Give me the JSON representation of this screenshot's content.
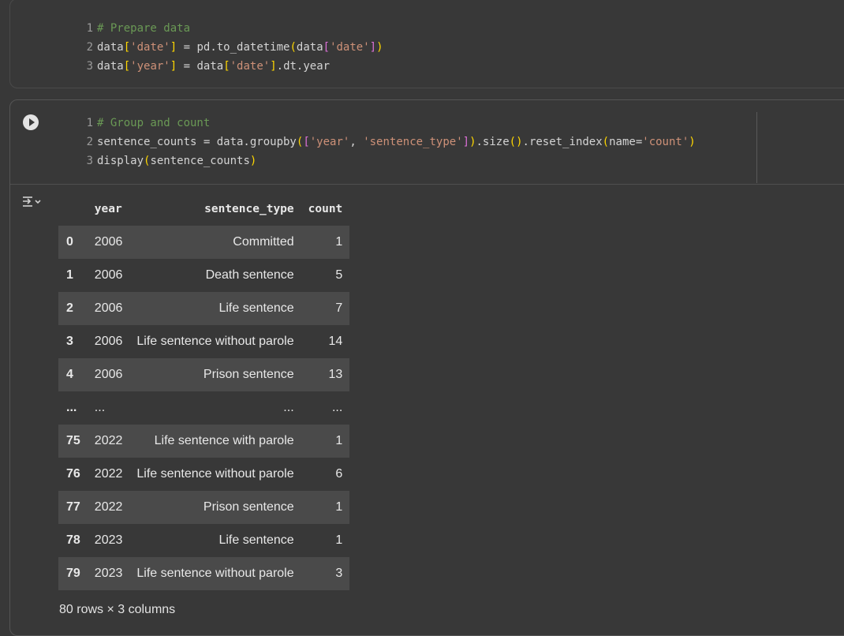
{
  "cell1": {
    "lines": [
      {
        "n": "1",
        "parts": [
          {
            "c": "cm",
            "t": "# Prepare data"
          }
        ]
      },
      {
        "n": "2",
        "parts": [
          {
            "c": "",
            "t": "data"
          },
          {
            "c": "br1",
            "t": "["
          },
          {
            "c": "str",
            "t": "'date'"
          },
          {
            "c": "br1",
            "t": "]"
          },
          {
            "c": "",
            "t": " = pd.to_datetime"
          },
          {
            "c": "br1",
            "t": "("
          },
          {
            "c": "",
            "t": "data"
          },
          {
            "c": "br2",
            "t": "["
          },
          {
            "c": "str",
            "t": "'date'"
          },
          {
            "c": "br2",
            "t": "]"
          },
          {
            "c": "br1",
            "t": ")"
          }
        ]
      },
      {
        "n": "3",
        "parts": [
          {
            "c": "",
            "t": "data"
          },
          {
            "c": "br1",
            "t": "["
          },
          {
            "c": "str",
            "t": "'year'"
          },
          {
            "c": "br1",
            "t": "]"
          },
          {
            "c": "",
            "t": " = data"
          },
          {
            "c": "br1",
            "t": "["
          },
          {
            "c": "str",
            "t": "'date'"
          },
          {
            "c": "br1",
            "t": "]"
          },
          {
            "c": "",
            "t": ".dt.year"
          }
        ]
      }
    ]
  },
  "cell2": {
    "lines": [
      {
        "n": "1",
        "parts": [
          {
            "c": "cm",
            "t": "# Group and count"
          }
        ]
      },
      {
        "n": "2",
        "parts": [
          {
            "c": "",
            "t": "sentence_counts = data.groupby"
          },
          {
            "c": "br1",
            "t": "("
          },
          {
            "c": "br2",
            "t": "["
          },
          {
            "c": "str",
            "t": "'year'"
          },
          {
            "c": "",
            "t": ", "
          },
          {
            "c": "str",
            "t": "'sentence_type'"
          },
          {
            "c": "br2",
            "t": "]"
          },
          {
            "c": "br1",
            "t": ")"
          },
          {
            "c": "",
            "t": ".size"
          },
          {
            "c": "br1",
            "t": "()"
          },
          {
            "c": "",
            "t": ".reset_index"
          },
          {
            "c": "br1",
            "t": "("
          },
          {
            "c": "",
            "t": "name="
          },
          {
            "c": "str",
            "t": "'count'"
          },
          {
            "c": "br1",
            "t": ")"
          }
        ]
      },
      {
        "n": "3",
        "parts": [
          {
            "c": "",
            "t": "display"
          },
          {
            "c": "br1",
            "t": "("
          },
          {
            "c": "",
            "t": "sentence_counts"
          },
          {
            "c": "br1",
            "t": ")"
          }
        ]
      }
    ]
  },
  "output": {
    "columns": {
      "year": "year",
      "sentence_type": "sentence_type",
      "count": "count"
    },
    "rows": [
      {
        "idx": "0",
        "year": "2006",
        "sentence_type": "Committed",
        "count": "1"
      },
      {
        "idx": "1",
        "year": "2006",
        "sentence_type": "Death sentence",
        "count": "5"
      },
      {
        "idx": "2",
        "year": "2006",
        "sentence_type": "Life sentence",
        "count": "7"
      },
      {
        "idx": "3",
        "year": "2006",
        "sentence_type": "Life sentence without parole",
        "count": "14"
      },
      {
        "idx": "4",
        "year": "2006",
        "sentence_type": "Prison sentence",
        "count": "13"
      },
      {
        "idx": "...",
        "year": "...",
        "sentence_type": "...",
        "count": "..."
      },
      {
        "idx": "75",
        "year": "2022",
        "sentence_type": "Life sentence with parole",
        "count": "1"
      },
      {
        "idx": "76",
        "year": "2022",
        "sentence_type": "Life sentence without parole",
        "count": "6"
      },
      {
        "idx": "77",
        "year": "2022",
        "sentence_type": "Prison sentence",
        "count": "1"
      },
      {
        "idx": "78",
        "year": "2023",
        "sentence_type": "Life sentence",
        "count": "1"
      },
      {
        "idx": "79",
        "year": "2023",
        "sentence_type": "Life sentence without parole",
        "count": "3"
      }
    ],
    "shape": "80 rows × 3 columns"
  },
  "icons": {
    "run": "run-cell-icon",
    "output": "output-toggle-icon"
  }
}
